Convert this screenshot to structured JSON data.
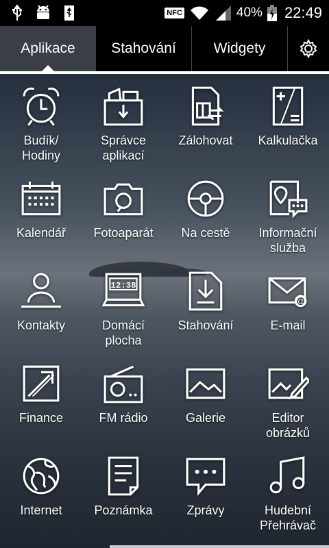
{
  "status_bar": {
    "icons": [
      "usb-icon",
      "android-debug-icon",
      "usb-storage-icon",
      "nfc-icon",
      "wifi-icon",
      "signal-icon",
      "battery-icon"
    ],
    "nfc_label": "NFC",
    "battery_percent": "40%",
    "time": "22:49"
  },
  "tabs": [
    {
      "label": "Aplikace",
      "active": true
    },
    {
      "label": "Stahování",
      "active": false
    },
    {
      "label": "Widgety",
      "active": false
    }
  ],
  "apps": [
    {
      "label": "Budík/\nHodiny",
      "icon": "alarm-clock-icon"
    },
    {
      "label": "Správce\naplikací",
      "icon": "app-manager-icon"
    },
    {
      "label": "Zálohovat",
      "icon": "backup-icon"
    },
    {
      "label": "Kalkulačka",
      "icon": "calculator-icon"
    },
    {
      "label": "Kalendář",
      "icon": "calendar-icon"
    },
    {
      "label": "Fotoaparát",
      "icon": "camera-icon"
    },
    {
      "label": "Na cestě",
      "icon": "steering-wheel-icon"
    },
    {
      "label": "Informační\nslužba",
      "icon": "info-service-icon"
    },
    {
      "label": "Kontakty",
      "icon": "contacts-icon"
    },
    {
      "label": "Domácí\nplocha",
      "icon": "home-screen-icon"
    },
    {
      "label": "Stahování",
      "icon": "download-icon"
    },
    {
      "label": "E-mail",
      "icon": "email-icon"
    },
    {
      "label": "Finance",
      "icon": "finance-icon"
    },
    {
      "label": "FM rádio",
      "icon": "radio-icon"
    },
    {
      "label": "Galerie",
      "icon": "gallery-icon"
    },
    {
      "label": "Editor\nobrázků",
      "icon": "image-editor-icon"
    },
    {
      "label": "Internet",
      "icon": "globe-icon"
    },
    {
      "label": "Poznámka",
      "icon": "memo-icon"
    },
    {
      "label": "Zprávy",
      "icon": "messages-icon"
    },
    {
      "label": "Hudební\nPřehrávač",
      "icon": "music-player-icon"
    }
  ],
  "home_screen_clock": "12:38"
}
